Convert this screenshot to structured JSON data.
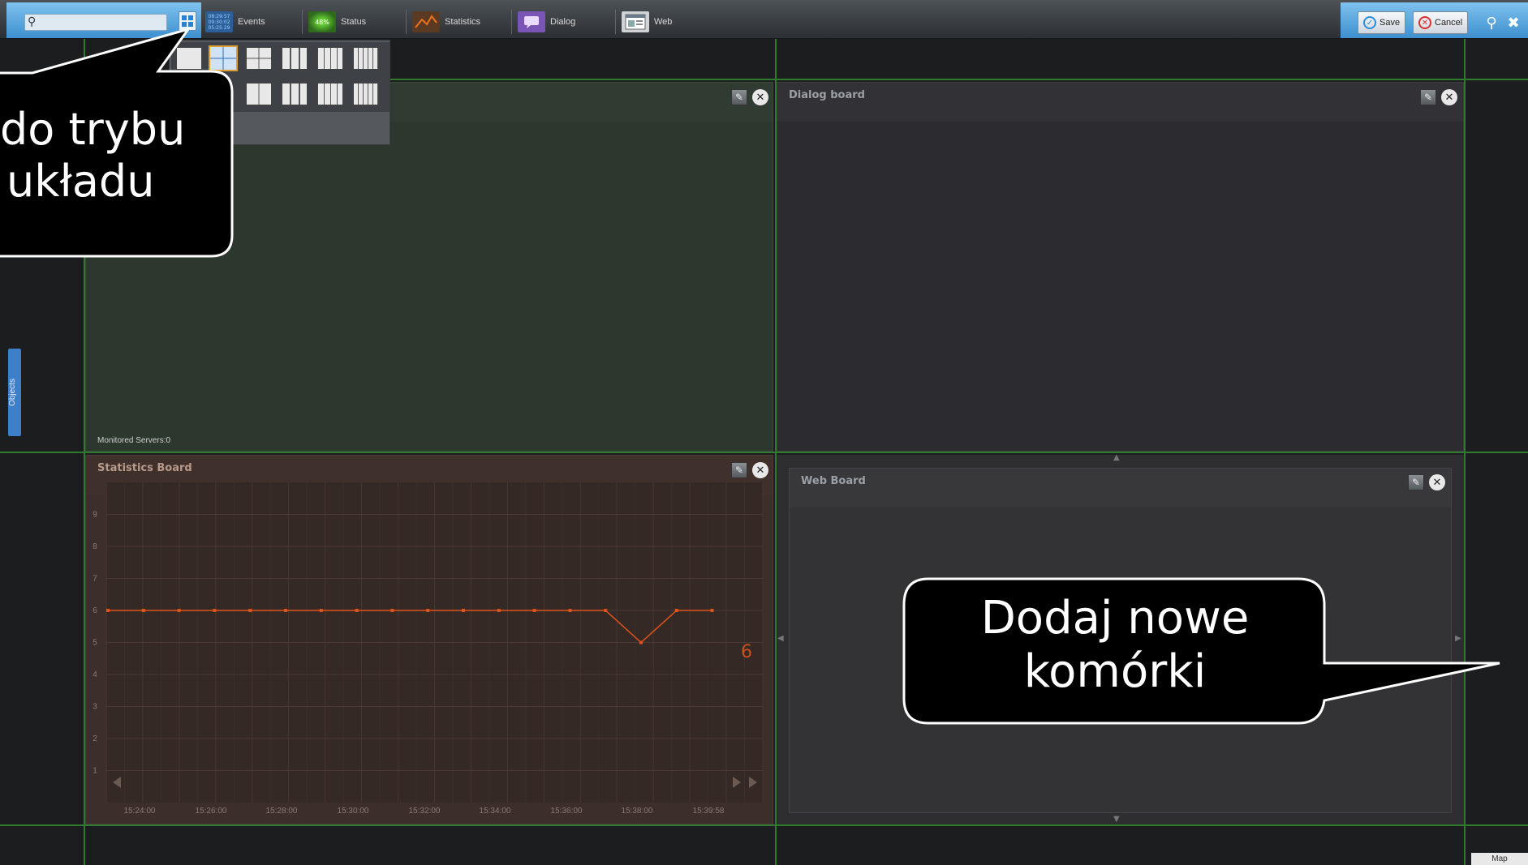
{
  "search": {
    "placeholder": "",
    "value": ""
  },
  "toolbar": {
    "items": [
      {
        "label": "Events",
        "icon": "events-icon",
        "badge": "08:29:57"
      },
      {
        "label": "Status",
        "icon": "status-icon",
        "badge": "48%"
      },
      {
        "label": "Statistics",
        "icon": "statistics-icon"
      },
      {
        "label": "Dialog",
        "icon": "dialog-icon"
      },
      {
        "label": "Web",
        "icon": "web-icon"
      }
    ],
    "events_times": [
      "08:29:57",
      "09:30:02",
      "05:25:29"
    ],
    "save_label": "Save",
    "cancel_label": "Cancel"
  },
  "boards": {
    "status": {
      "title": "",
      "footer": "Monitored Servers:0"
    },
    "dialog": {
      "title": "Dialog board"
    },
    "statistics": {
      "title": "Statistics Board"
    },
    "web": {
      "title": "Web Board"
    }
  },
  "sidebar": {
    "objects_label": "Objects"
  },
  "map_label": "Map",
  "callouts": {
    "layout_mode_line1": "do trybu",
    "layout_mode_line2": "układu",
    "add_cells_line1": "Dodaj nowe",
    "add_cells_line2": "komórki"
  },
  "colors": {
    "accent_blue": "#4a9ee0",
    "grid_green": "#2f7a2f",
    "series_orange": "#e0541c",
    "status_board_bg": "#2c382e",
    "dialog_board_bg": "#2c2c30",
    "statistics_board_bg": "#3b2e2b",
    "web_board_bg": "#333335"
  },
  "chart_data": {
    "type": "line",
    "title": "",
    "xlabel": "",
    "ylabel": "",
    "ylim": [
      0,
      10
    ],
    "y_ticks": [
      "1",
      "2",
      "3",
      "4",
      "5",
      "6",
      "7",
      "8",
      "9"
    ],
    "x_ticks": [
      "15:24:00",
      "15:26:00",
      "15:28:00",
      "15:30:00",
      "15:32:00",
      "15:34:00",
      "15:36:00",
      "15:38:00",
      "15:39:58"
    ],
    "current_value": "6",
    "series": [
      {
        "values": [
          6,
          6,
          6,
          6,
          6,
          6,
          6,
          6,
          6,
          6,
          6,
          6,
          6,
          6,
          6,
          5,
          6,
          6
        ]
      }
    ],
    "grid": true
  }
}
